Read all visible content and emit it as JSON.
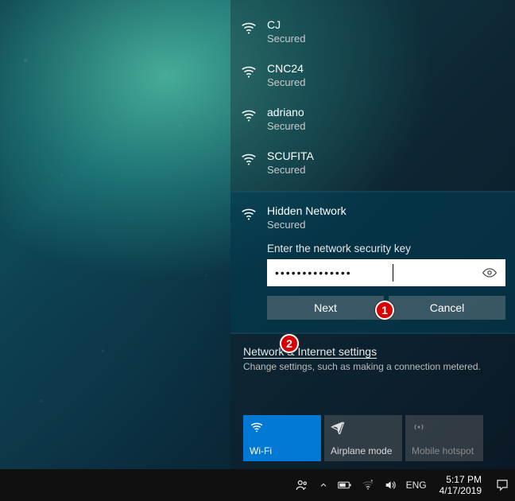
{
  "networks": [
    {
      "name": "CJ",
      "status": "Secured"
    },
    {
      "name": "CNC24",
      "status": "Secured"
    },
    {
      "name": "adriano",
      "status": "Secured"
    },
    {
      "name": "SCUFITA",
      "status": "Secured"
    }
  ],
  "selected": {
    "name": "Hidden Network",
    "status": "Secured",
    "prompt": "Enter the network security key",
    "password_display": "••••••••••••••",
    "next_label": "Next",
    "cancel_label": "Cancel"
  },
  "settings": {
    "link": "Network & Internet settings",
    "desc": "Change settings, such as making a connection metered."
  },
  "tiles": {
    "wifi": "Wi-Fi",
    "airplane": "Airplane mode",
    "hotspot": "Mobile hotspot"
  },
  "taskbar": {
    "lang": "ENG",
    "time": "5:17 PM",
    "date": "4/17/2019"
  },
  "callouts": {
    "c1": "1",
    "c2": "2"
  }
}
